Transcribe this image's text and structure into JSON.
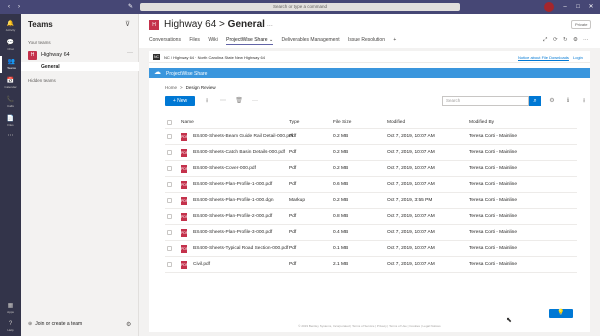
{
  "topbar": {
    "back": "‹",
    "forward": "›",
    "compose": "✎",
    "search_placeholder": "Search or type a command",
    "minimize": "–",
    "maximize": "□",
    "close": "✕"
  },
  "rail": [
    {
      "icon": "🔔",
      "label": "Activity"
    },
    {
      "icon": "💬",
      "label": "Chat"
    },
    {
      "icon": "👥",
      "label": "Teams"
    },
    {
      "icon": "📅",
      "label": "Calendar"
    },
    {
      "icon": "📞",
      "label": "Calls"
    },
    {
      "icon": "📄",
      "label": "Files"
    },
    {
      "icon": "⋯",
      "label": ""
    },
    {
      "icon": "▦",
      "label": "Apps"
    },
    {
      "icon": "?",
      "label": "Help"
    }
  ],
  "teams_panel": {
    "title": "Teams",
    "filter": "⊽",
    "your_teams": "Your teams",
    "team_initials": "H",
    "team_name": "Highway 64",
    "team_more": "···",
    "channel": "General",
    "hidden_teams": "Hidden teams",
    "join_plus": "⊕",
    "join_label": "Join or create a team",
    "settings": "⚙"
  },
  "channel_header": {
    "initials": "H",
    "team": "Highway 64",
    "separator": " > ",
    "channel": "General",
    "more": "···",
    "badge": "Private",
    "tabs": [
      "Conversations",
      "Files",
      "Wiki",
      "ProjectWise Share ⌄",
      "Deliverables Management",
      "Issue Resolution",
      "+"
    ],
    "active_tab": 3,
    "right_icons": [
      "⤢",
      "⟳",
      "↻",
      "⚙",
      "···"
    ]
  },
  "projectwise": {
    "logo": "NC",
    "breadcrumb_text": "NC / Highway 64  ·  North Carolina State New Highway 64",
    "notice": "Notice about File Downloads",
    "login": "Login",
    "banner": "ProjectWise Share",
    "path_home": "Home",
    "path_sep": ">",
    "path_current": "Design Review",
    "new_button": "+ New",
    "toolbar_icons": [
      "⭳",
      "⋯",
      "🗑",
      "···"
    ],
    "search_placeholder": "Search",
    "search_icon": "⌕",
    "right_icons": [
      "⚙",
      "ℹ",
      "⭳"
    ],
    "columns": {
      "name": "Name",
      "type": "Type",
      "size": "File Size",
      "modified": "Modified",
      "modified_by": "Modified By"
    },
    "files": [
      {
        "name": "BS400-Sheets-Beam Guide Rail Detail-000.pdf",
        "type": "Pdf",
        "size": "0.2 MB",
        "modified": "Oct 7, 2019, 10:07 AM",
        "by": "Teresa Corti - Mainline"
      },
      {
        "name": "BS400-Sheets-Catch Basin Details-000.pdf",
        "type": "Pdf",
        "size": "0.2 MB",
        "modified": "Oct 7, 2019, 10:07 AM",
        "by": "Teresa Corti - Mainline"
      },
      {
        "name": "BS400-Sheets-Cover-000.pdf",
        "type": "Pdf",
        "size": "0.2 MB",
        "modified": "Oct 7, 2019, 10:07 AM",
        "by": "Teresa Corti - Mainline"
      },
      {
        "name": "BS400-Sheets-Plan-Profile-1-000.pdf",
        "type": "Pdf",
        "size": "0.6 MB",
        "modified": "Oct 7, 2019, 10:07 AM",
        "by": "Teresa Corti - Mainline"
      },
      {
        "name": "BS400-Sheets-Plan-Profile-1-000.dgn",
        "type": "Markup",
        "size": "0.2 MB",
        "modified": "Oct 7, 2019, 3:55 PM",
        "by": "Teresa Corti - Mainline"
      },
      {
        "name": "BS400-Sheets-Plan-Profile-2-000.pdf",
        "type": "Pdf",
        "size": "0.8 MB",
        "modified": "Oct 7, 2019, 10:07 AM",
        "by": "Teresa Corti - Mainline"
      },
      {
        "name": "BS400-Sheets-Plan-Profile-3-000.pdf",
        "type": "Pdf",
        "size": "0.4 MB",
        "modified": "Oct 7, 2019, 10:07 AM",
        "by": "Teresa Corti - Mainline"
      },
      {
        "name": "BS400-Sheets-Typical Road Section-000.pdf",
        "type": "Pdf",
        "size": "0.1 MB",
        "modified": "Oct 7, 2019, 10:07 AM",
        "by": "Teresa Corti - Mainline"
      },
      {
        "name": "Civil.pdf",
        "type": "Pdf",
        "size": "2.1 MB",
        "modified": "Oct 7, 2019, 10:07 AM",
        "by": "Teresa Corti - Mainline"
      }
    ],
    "file_icon_label": "PDF",
    "footer": "© 2019 Bentley Systems, Incorporated  |  Terms of Service  |  Privacy  |  Terms of Use  |  Cookies  |  Legal Notices",
    "help_icon": "💡"
  },
  "colors": {
    "teams_purple": "#464775",
    "rail": "#33344a",
    "accent": "#0078d4",
    "pdf_red": "#c4314b",
    "banner": "#3a96dd"
  }
}
